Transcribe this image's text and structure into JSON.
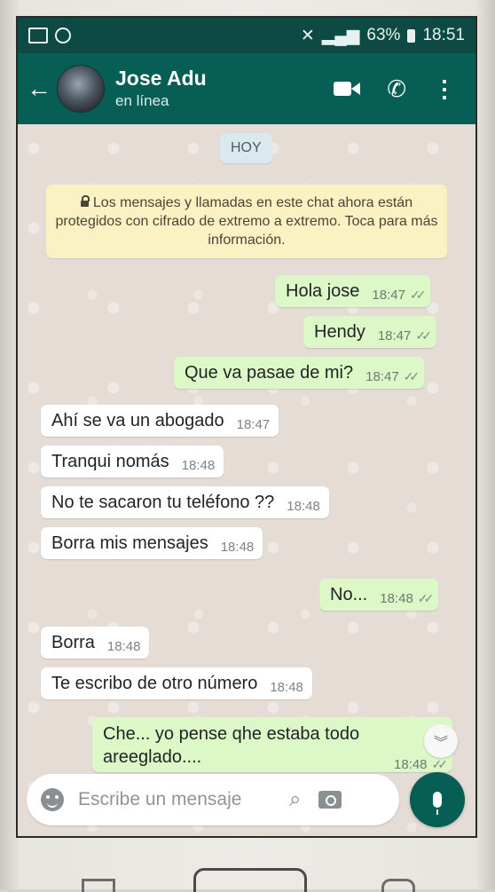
{
  "status_bar": {
    "battery": "63%",
    "time": "18:51"
  },
  "header": {
    "back_icon": "arrow-back-icon",
    "contact_name": "Jose Adu",
    "contact_status": "en línea",
    "video_icon": "video-call-icon",
    "phone_icon": "voice-call-icon",
    "menu_icon": "more-options-icon"
  },
  "chat": {
    "day_label": "HOY",
    "encryption_notice": "Los mensajes y llamadas en este chat ahora están protegidos con cifrado de extremo a extremo. Toca para más información.",
    "messages": [
      {
        "direction": "out",
        "text": "Hola jose",
        "time": "18:47",
        "status": "read"
      },
      {
        "direction": "out",
        "text": "Hendy",
        "time": "18:47",
        "status": "read"
      },
      {
        "direction": "out",
        "text": "Que va pasae de mi?",
        "time": "18:47",
        "status": "read"
      },
      {
        "direction": "in",
        "text": "Ahí se va un abogado",
        "time": "18:47"
      },
      {
        "direction": "in",
        "text": "Tranqui nomás",
        "time": "18:48"
      },
      {
        "direction": "in",
        "text": "No te sacaron tu teléfono ??",
        "time": "18:48"
      },
      {
        "direction": "in",
        "text": "Borra mis mensajes",
        "time": "18:48"
      },
      {
        "direction": "out",
        "text": "No...",
        "time": "18:48",
        "status": "read"
      },
      {
        "direction": "in",
        "text": "Borra",
        "time": "18:48"
      },
      {
        "direction": "in",
        "text": "Te escribo de otro número",
        "time": "18:48"
      },
      {
        "direction": "out",
        "text": "Che... yo pense qhe estaba todo areeglado....",
        "time": "18:48",
        "status": "read"
      }
    ]
  },
  "composer": {
    "placeholder": "Escribe un mensaje",
    "emoji_icon": "emoji-icon",
    "attach_icon": "attach-icon",
    "camera_icon": "camera-icon",
    "mic_icon": "mic-icon",
    "scroll_icon": "chevron-double-down-icon"
  },
  "colors": {
    "header": "#075e55",
    "status_bar": "#0e4a44",
    "outgoing_bubble": "#dcf8c6",
    "incoming_bubble": "#ffffff",
    "chat_background": "#e5ddd5",
    "encryption_notice": "#fbf2c4"
  }
}
